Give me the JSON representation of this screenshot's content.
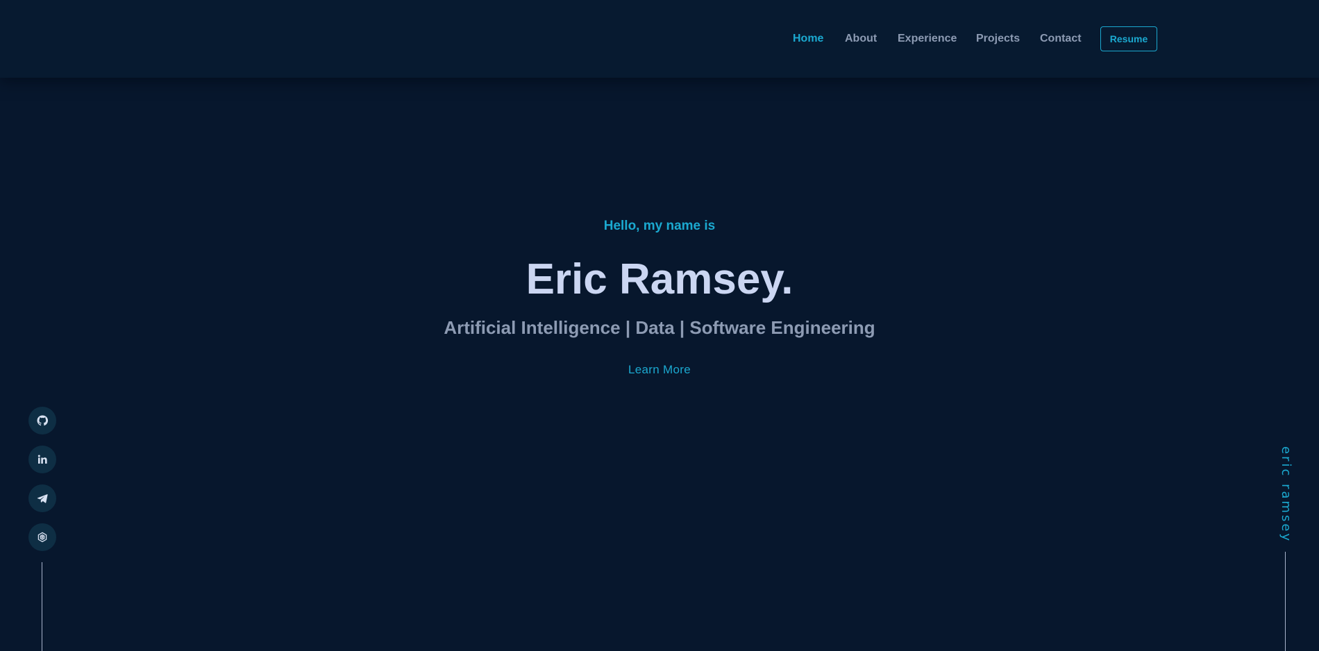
{
  "nav": {
    "items": [
      {
        "label": "Home",
        "active": true
      },
      {
        "label": "About",
        "active": false
      },
      {
        "label": "Experience",
        "active": false
      },
      {
        "label": "Projects",
        "active": false
      },
      {
        "label": "Contact",
        "active": false
      }
    ],
    "resume_label": "Resume"
  },
  "hero": {
    "greeting": "Hello, my name is",
    "name": "Eric Ramsey.",
    "tagline": "Artificial Intelligence | Data | Software Engineering",
    "cta_label": "Learn More"
  },
  "social": [
    {
      "icon": "github-icon"
    },
    {
      "icon": "linkedin-icon"
    },
    {
      "icon": "telegram-icon"
    },
    {
      "icon": "hexagon-logo-icon"
    }
  ],
  "side_brand": "eric ramsey",
  "colors": {
    "background": "#07172d",
    "navbar": "#071a30",
    "accent": "#1ba9d0",
    "heading": "#cbd6f2",
    "muted": "#8d9bb3",
    "social_bg": "#0e2e44",
    "line": "#a8b4cc"
  }
}
